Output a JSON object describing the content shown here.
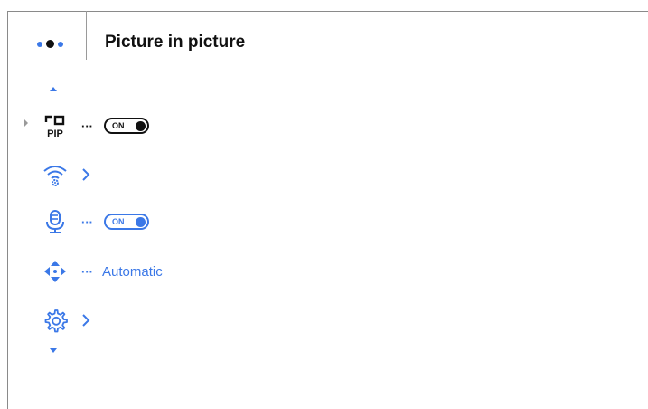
{
  "header": {
    "title": "Picture in picture",
    "menu_icon": "three-dots-icon"
  },
  "menu": {
    "items": [
      {
        "icon": "pip-icon",
        "icon_label": "PIP",
        "state": "ON",
        "control": "toggle",
        "selected": true
      },
      {
        "icon": "wifi-settings-icon",
        "control": "chevron"
      },
      {
        "icon": "microphone-icon",
        "state": "ON",
        "control": "toggle"
      },
      {
        "icon": "calibration-arrows-icon",
        "value": "Automatic",
        "control": "value"
      },
      {
        "icon": "gear-icon",
        "control": "chevron"
      }
    ]
  },
  "colors": {
    "accent": "#3b78e7",
    "text": "#111111",
    "divider": "#9a9a9a"
  }
}
